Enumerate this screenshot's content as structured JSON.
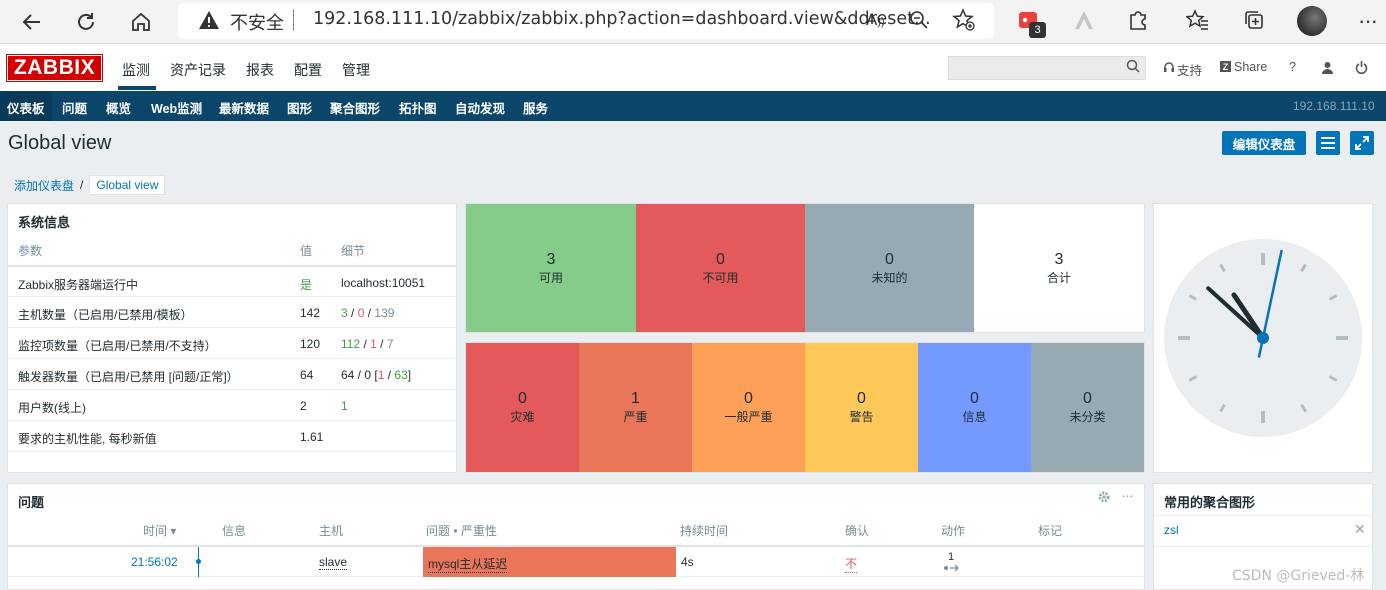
{
  "browser": {
    "security_warning": "不安全",
    "url": "192.168.111.10/zabbix/zabbix.php?action=dashboard.view&ddreset...",
    "extension_badge": "3"
  },
  "header": {
    "logo": "ZABBIX",
    "menu": [
      "监测",
      "资产记录",
      "报表",
      "配置",
      "管理"
    ],
    "support": "支持",
    "share": "Share",
    "help": "?"
  },
  "subnav": {
    "items": [
      "仪表板",
      "问题",
      "概览",
      "Web监测",
      "最新数据",
      "图形",
      "聚合图形",
      "拓扑图",
      "自动发现",
      "服务"
    ],
    "server_ip": "192.168.111.10"
  },
  "page": {
    "title": "Global view",
    "edit_button": "编辑仪表盘",
    "breadcrumb": [
      "添加仪表盘",
      "Global view"
    ]
  },
  "system_info": {
    "title": "系统信息",
    "headers": [
      "参数",
      "值",
      "细节"
    ],
    "rows": [
      {
        "param": "Zabbix服务器端运行中",
        "value": "是",
        "detail": "localhost:10051"
      },
      {
        "param": "主机数量（已启用/已禁用/模板）",
        "value": "142",
        "d1": "3",
        "d2": "0",
        "d3": "139"
      },
      {
        "param": "监控项数量（已启用/已禁用/不支持）",
        "value": "120",
        "d1": "112",
        "d2": "1",
        "d3": "7"
      },
      {
        "param": "触发器数量（已启用/已禁用 [问题/正常]）",
        "value": "64",
        "d1": "64 / 0 [",
        "d2": "1",
        "d3": "63",
        "d4": "]"
      },
      {
        "param": "用户数(线上)",
        "value": "2",
        "d1": "1"
      },
      {
        "param": "要求的主机性能, 每秒新值",
        "value": "1.61"
      }
    ]
  },
  "host_availability": [
    {
      "count": "3",
      "label": "可用",
      "color": "#86cc89"
    },
    {
      "count": "0",
      "label": "不可用",
      "color": "#e45959"
    },
    {
      "count": "0",
      "label": "未知的",
      "color": "#97aab3"
    },
    {
      "count": "3",
      "label": "合计",
      "color": "#ffffff"
    }
  ],
  "problems_by_severity": [
    {
      "count": "0",
      "label": "灾难",
      "color": "#e45959"
    },
    {
      "count": "1",
      "label": "严重",
      "color": "#e97659"
    },
    {
      "count": "0",
      "label": "一般严重",
      "color": "#ffa059"
    },
    {
      "count": "0",
      "label": "警告",
      "color": "#ffc859"
    },
    {
      "count": "0",
      "label": "信息",
      "color": "#7499ff"
    },
    {
      "count": "0",
      "label": "未分类",
      "color": "#97aab3"
    }
  ],
  "clock": {
    "hour": 10,
    "minute": 52,
    "second": 2
  },
  "problems": {
    "title": "问题",
    "headers": [
      "时间 ▾",
      "信息",
      "主机",
      "问题 • 严重性",
      "持续时间",
      "确认",
      "动作",
      "标记"
    ],
    "rows": [
      {
        "time": "21:56:02",
        "host": "slave",
        "problem": "mysql主从延迟",
        "duration": "4s",
        "ack": "不",
        "actions": "1"
      }
    ]
  },
  "favorites": {
    "title": "常用的聚合图形",
    "items": [
      "zsl"
    ]
  },
  "watermark": "CSDN @Grieved-林"
}
